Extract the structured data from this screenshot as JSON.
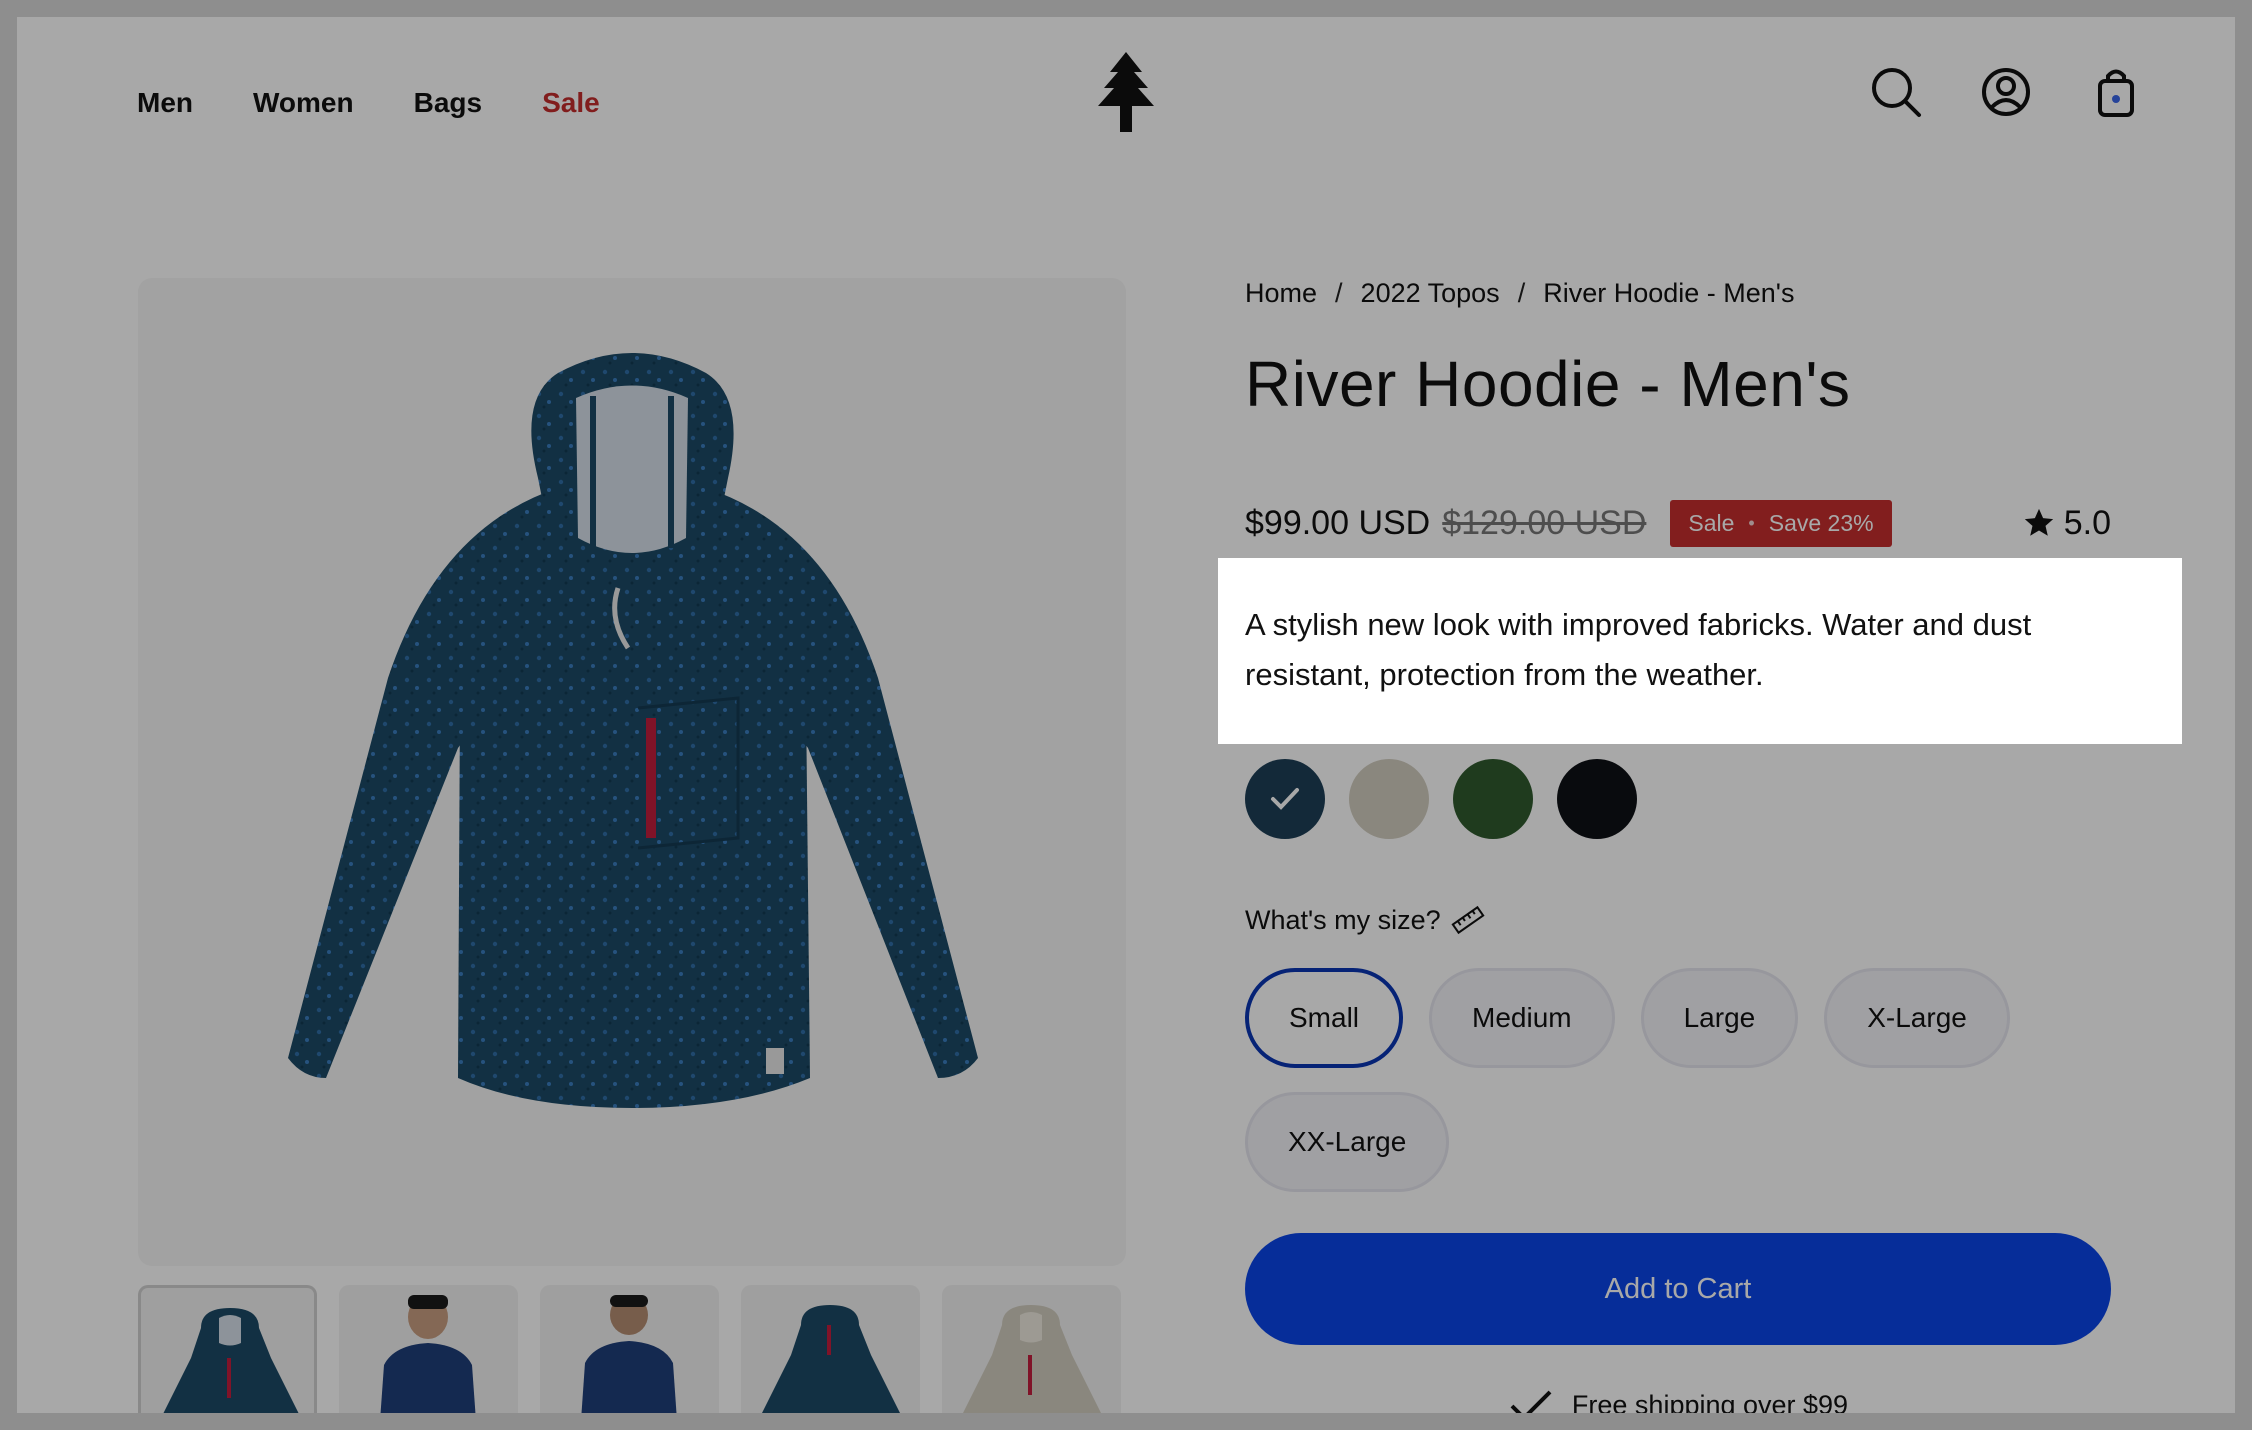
{
  "header": {
    "nav": [
      "Men",
      "Women",
      "Bags",
      "Sale"
    ],
    "icons": [
      "search-icon",
      "account-icon",
      "cart-icon"
    ],
    "logo": "tree-logo"
  },
  "breadcrumb": [
    "Home",
    "2022 Topos",
    "River Hoodie - Men's"
  ],
  "product": {
    "title": "River Hoodie - Men's",
    "price": "$99.00 USD",
    "compare_price": "$129.00 USD",
    "badge_sale": "Sale",
    "badge_save": "Save 23%",
    "rating": "5.0",
    "description": "A stylish new look with improved fabricks. Water and dust resistant, protection from the weather.",
    "colors": [
      "#1d3f57",
      "#d2cdbf",
      "#2f5a2e",
      "#0f1116"
    ],
    "selected_color_index": 0,
    "size_label": "What's my size?",
    "sizes": [
      "Small",
      "Medium",
      "Large",
      "X-Large",
      "XX-Large"
    ],
    "selected_size": "Small",
    "add_to_cart": "Add to Cart",
    "shipping": "Free shipping over $99"
  },
  "colors": {
    "sale_red": "#c42d2d",
    "primary_blue": "#0a45e8",
    "overlay": "rgba(0,0,0,0.34)"
  }
}
